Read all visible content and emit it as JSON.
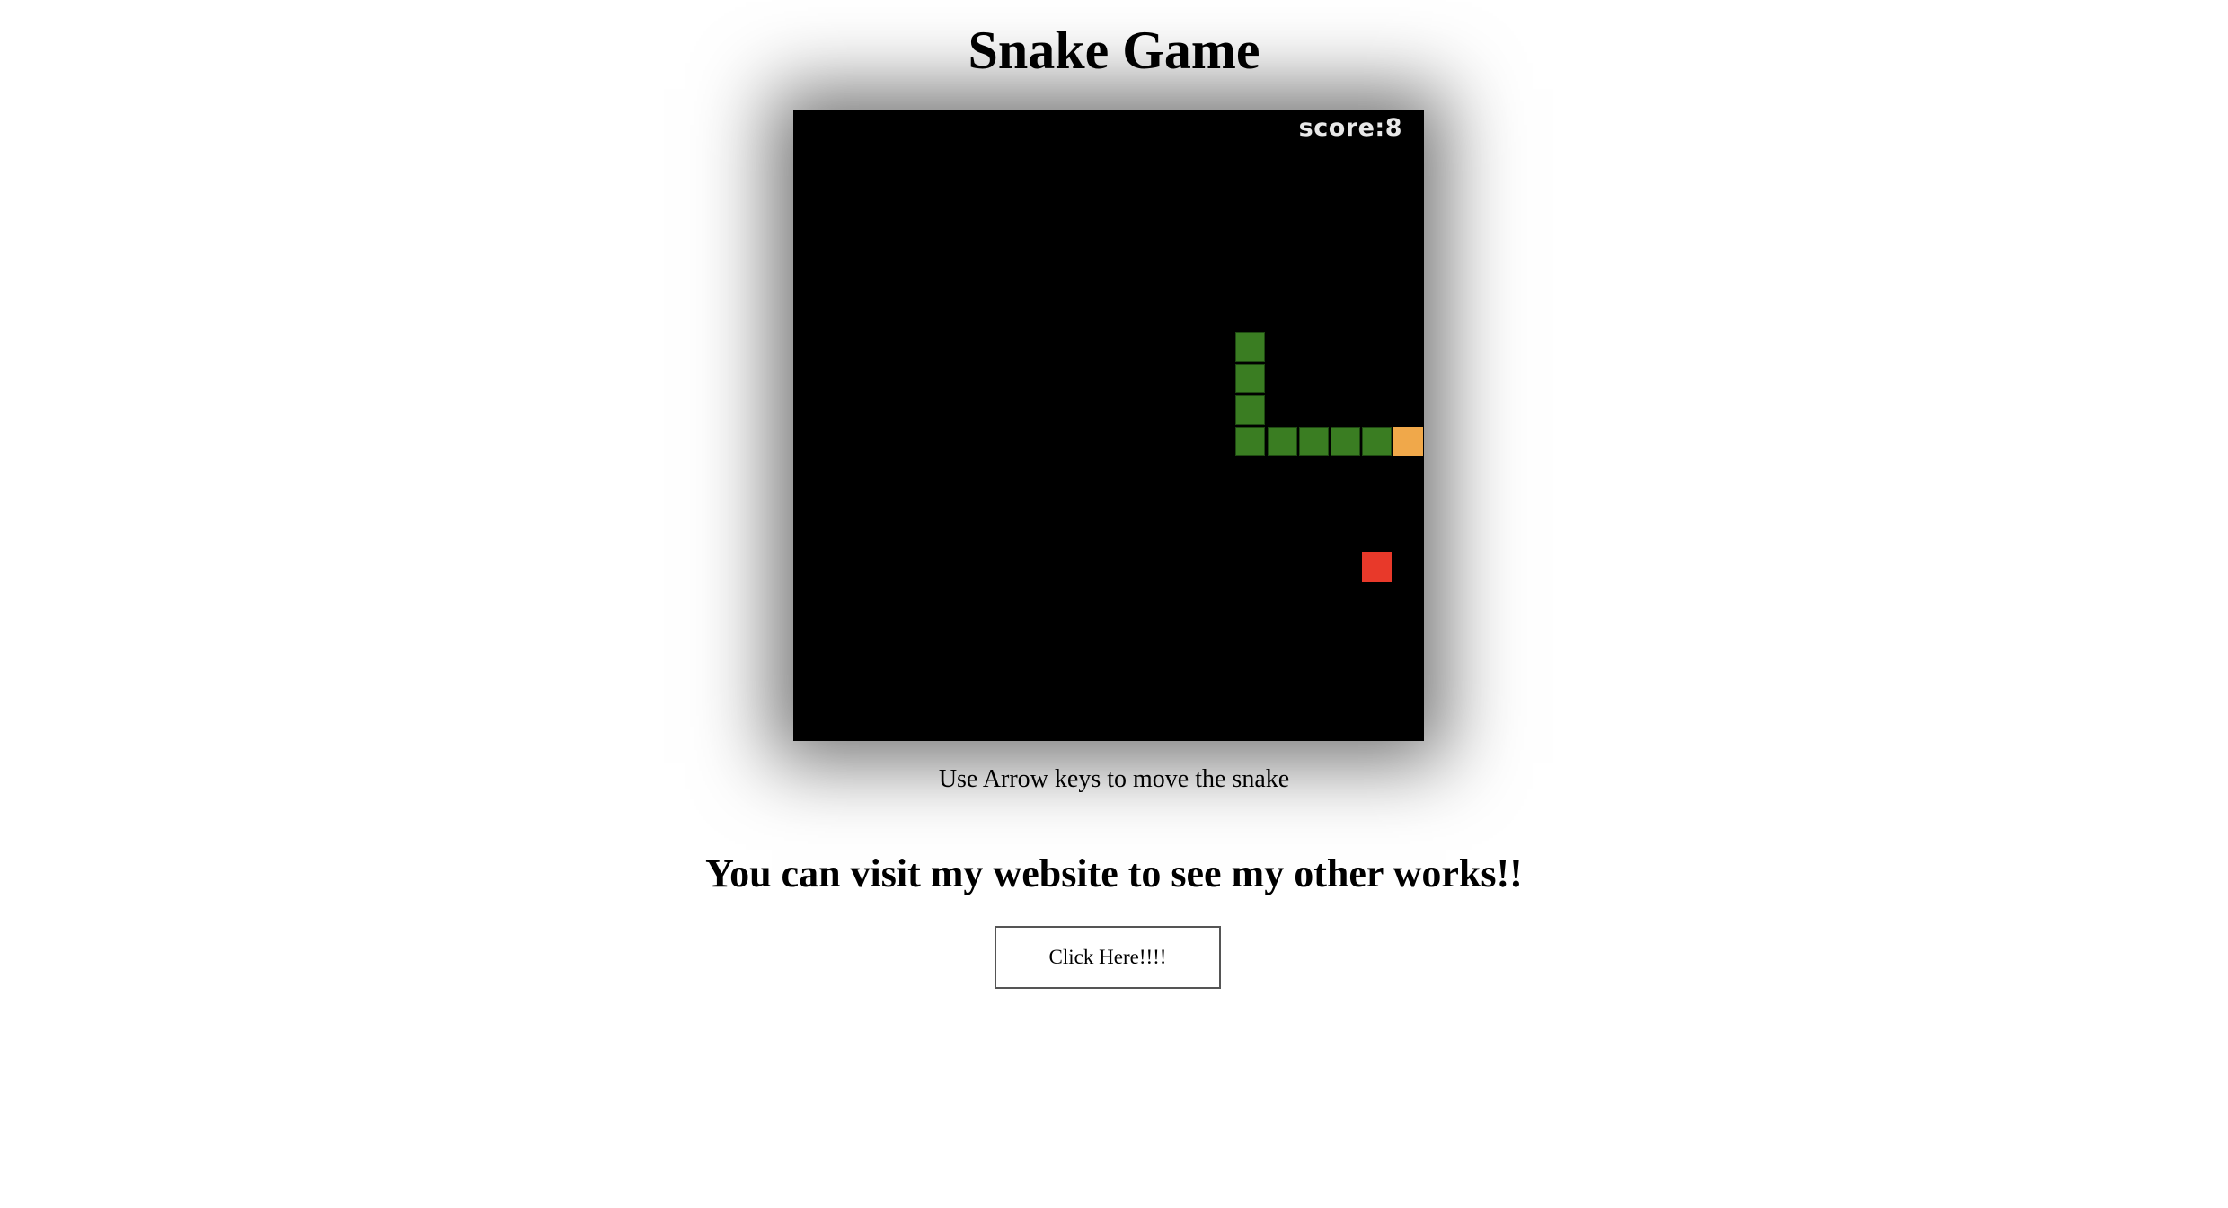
{
  "page": {
    "title": "Snake Game",
    "instructions": "Use Arrow keys to move the snake",
    "promo": "You can visit my website to see my other works!!"
  },
  "game": {
    "score_label": "score:",
    "score": 8,
    "score_text": "score:8",
    "grid_cols": 20,
    "grid_rows": 20,
    "colors": {
      "background": "#000000",
      "snake_body": "#3a7d22",
      "snake_body_border": "#1f4a12",
      "snake_head": "#f0a84a",
      "food": "#e8392a"
    },
    "snake": [
      {
        "col": 19,
        "row": 10,
        "part": "head"
      },
      {
        "col": 18,
        "row": 10,
        "part": "body"
      },
      {
        "col": 17,
        "row": 10,
        "part": "body"
      },
      {
        "col": 16,
        "row": 10,
        "part": "body"
      },
      {
        "col": 15,
        "row": 10,
        "part": "body"
      },
      {
        "col": 14,
        "row": 10,
        "part": "body"
      },
      {
        "col": 14,
        "row": 9,
        "part": "body"
      },
      {
        "col": 14,
        "row": 8,
        "part": "body"
      },
      {
        "col": 14,
        "row": 7,
        "part": "body"
      }
    ],
    "food": {
      "col": 18,
      "row": 14
    }
  },
  "cta": {
    "label": "Click Here!!!!"
  }
}
